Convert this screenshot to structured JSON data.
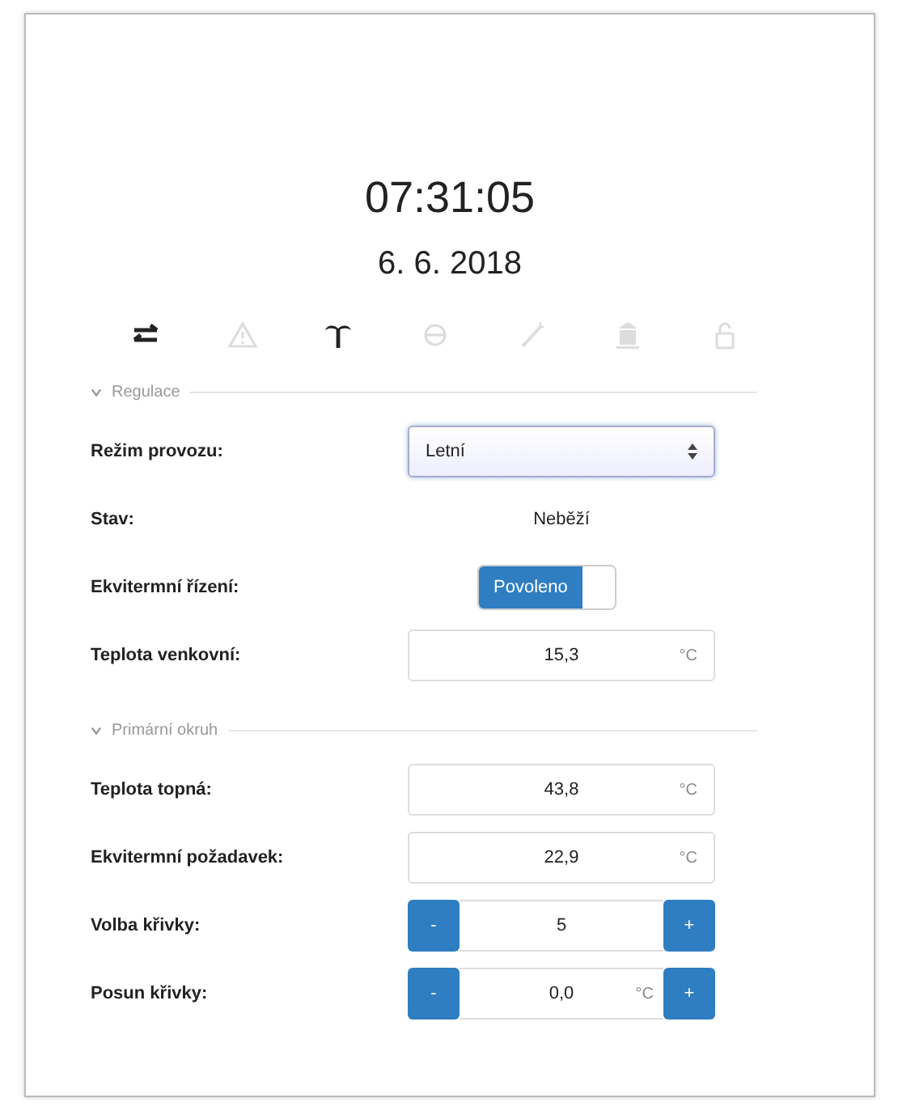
{
  "clock": {
    "time": "07:31:05",
    "date": "6. 6. 2018"
  },
  "toolbar": [
    {
      "kind": "arrows",
      "active": true
    },
    {
      "kind": "warning",
      "active": false
    },
    {
      "kind": "palm",
      "active": true
    },
    {
      "kind": "sun",
      "active": false
    },
    {
      "kind": "wand",
      "active": false
    },
    {
      "kind": "building",
      "active": false
    },
    {
      "kind": "lock",
      "active": false
    }
  ],
  "sections": [
    {
      "title": "Regulace",
      "expanded": true,
      "rows": [
        {
          "kind": "select",
          "label": "Režim provozu:",
          "value": "Letní"
        },
        {
          "kind": "text",
          "label": "Stav:",
          "value": "Neběží"
        },
        {
          "kind": "toggle",
          "label": "Ekvitermní řízení:",
          "value": "Povoleno",
          "on": true
        },
        {
          "kind": "number",
          "label": "Teplota venkovní:",
          "value": "15,3",
          "unit": "°C"
        }
      ]
    },
    {
      "title": "Primární okruh",
      "expanded": true,
      "rows": [
        {
          "kind": "number",
          "label": "Teplota topná:",
          "value": "43,8",
          "unit": "°C"
        },
        {
          "kind": "number",
          "label": "Ekvitermní požadavek:",
          "value": "22,9",
          "unit": "°C"
        },
        {
          "kind": "stepper",
          "label": "Volba křivky:",
          "value": "5",
          "minus": "-",
          "plus": "+"
        },
        {
          "kind": "stepper",
          "label": "Posun křivky:",
          "value": "0,0",
          "unit": "°C",
          "minus": "-",
          "plus": "+"
        }
      ]
    }
  ]
}
